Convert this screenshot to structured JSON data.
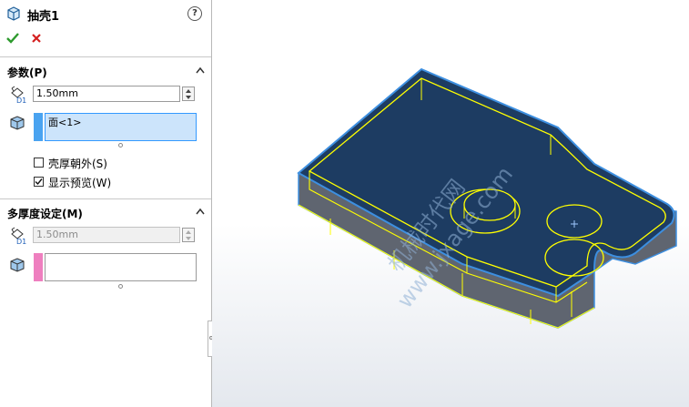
{
  "panel": {
    "title": "抽壳1",
    "help": "?",
    "params": {
      "header": "参数(P)",
      "thickness": "1.50mm",
      "faces_item": "面<1>",
      "shell_outward": {
        "label": "壳厚朝外(S)",
        "checked": false
      },
      "show_preview": {
        "label": "显示预览(W)",
        "checked": true
      }
    },
    "multi": {
      "header": "多厚度设定(M)",
      "thickness": "1.50mm"
    },
    "colors": {
      "face_swatch": "#4aa3f0",
      "multi_swatch": "#ee7fbf",
      "selected_list": "#cce4fb",
      "accent": "#3399ff"
    }
  },
  "viewport": {
    "watermark_line1": "机械时代网",
    "watermark_line2": "www.jxage.com",
    "colors": {
      "face": "#1d3c62",
      "side": "#5f6570",
      "edge": "#ffff00",
      "outline": "#3d8fe0"
    }
  }
}
